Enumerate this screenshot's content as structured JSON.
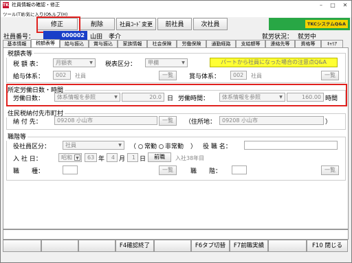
{
  "window": {
    "title": "社員情報の確認・修正",
    "app_icon": "TKC"
  },
  "menu": [
    "ツール(T)",
    "お気に入り(O)",
    "ヘルプ(H)"
  ],
  "toolbar": {
    "edit": "修正",
    "delete": "削除",
    "code_change": "社員ｺｰﾄﾞ変更",
    "prev": "前社員",
    "next": "次社員",
    "logo": "TKCシステムQ&A"
  },
  "header": {
    "emp_no_label": "社員番号：",
    "emp_no": "000002",
    "emp_name": "山田　孝介",
    "status_label": "就労状況：",
    "status": "就労中"
  },
  "tabs": [
    "基本情報",
    "税額表等",
    "給与振込",
    "賞与振込",
    "家族情報",
    "社会保険",
    "労働保険",
    "通勤経路",
    "支給額等",
    "連絡先等",
    "資格等",
    "ｷｬﾘｱ"
  ],
  "active_tab": "税額表等",
  "tax": {
    "group": "税額表等",
    "table_label": "税 額 表：",
    "table_value": "月額表",
    "class_label": "税表区分：",
    "class_value": "甲欄",
    "help_btn": "パートから社員になった場合の注意点Q&A",
    "pay_label": "給与体系：",
    "pay_code": "002",
    "pay_name": "社員",
    "list": "一覧",
    "bonus_label": "賞与体系：",
    "bonus_code": "002",
    "bonus_name": "社員"
  },
  "work": {
    "group": "所定労働日数・時間",
    "days_label": "労働日数：",
    "days_source": "体系情報を参照",
    "days_value": "20.0",
    "days_unit": "日",
    "hours_label": "労働時間：",
    "hours_source": "体系情報を参照",
    "hours_value": "160.00",
    "hours_unit": "時間"
  },
  "resident": {
    "group": "住民税納付先市町村",
    "label": "納 付 先：",
    "code": "09208",
    "city": "小山市",
    "list": "一覧",
    "address_label": "（住所地：",
    "address_code": "09208",
    "address_city": "小山市",
    "close": "）"
  },
  "position": {
    "group": "職階等",
    "officer_label": "役社員区分：",
    "officer_value": "社員",
    "paren_open": "（",
    "fulltime": "常勤",
    "parttime": "非常勤",
    "paren_close": "）",
    "title_label": "役 職 名：",
    "join_label": "入 社 日：",
    "era": "昭和",
    "year": "63",
    "year_unit": "年",
    "month": "4",
    "month_unit": "月",
    "day": "1",
    "day_unit": "日",
    "prev_btn": "前職",
    "join_note": "入社38年目",
    "job_label": "職　　種：",
    "rank_label": "職　　階：",
    "list": "一覧"
  },
  "fkeys": {
    "f4": "F4確認終了",
    "f6": "F6タブ切替",
    "f7": "F7前職実績",
    "f10": "F10 閉じる"
  }
}
